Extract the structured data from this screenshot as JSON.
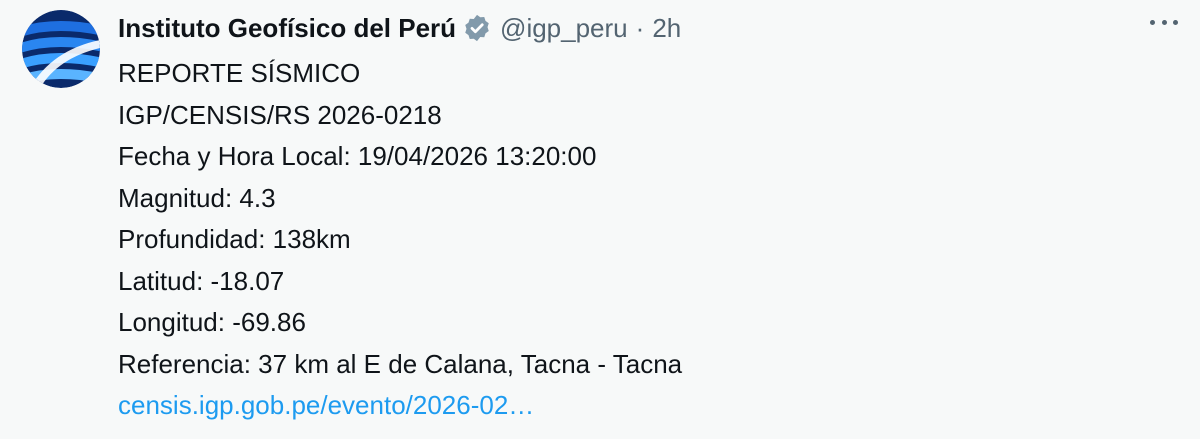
{
  "tweet": {
    "author_name": "Instituto Geofísico del Perú",
    "handle": "@igp_peru",
    "separator": "·",
    "time": "2h",
    "verified_icon": "verified-badge-icon",
    "more_icon": "more-options-icon",
    "avatar_icon": "igp-logo",
    "lines": [
      "REPORTE SÍSMICO",
      "IGP/CENSIS/RS 2026-0218",
      "Fecha y Hora Local: 19/04/2026 13:20:00",
      "Magnitud: 4.3",
      "Profundidad: 138km",
      "Latitud: -18.07",
      "Longitud: -69.86",
      "Referencia: 37 km al E de Calana, Tacna - Tacna"
    ],
    "link": "censis.igp.gob.pe/evento/2026-02…"
  },
  "colors": {
    "background": "#f7f9f9",
    "text": "#0f1419",
    "secondary": "#536471",
    "link": "#1d9bf0",
    "logo_blue": "#1a73e8"
  }
}
